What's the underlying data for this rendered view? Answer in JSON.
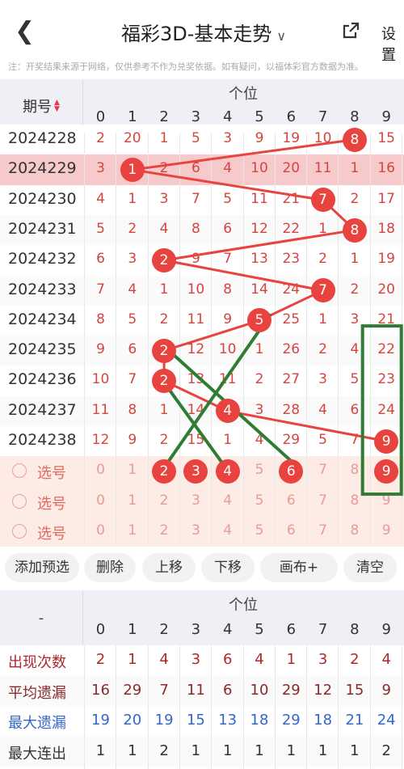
{
  "header": {
    "back_icon": "chevron-left-icon",
    "title": "福彩3D-基本走势",
    "share_icon": "share-icon",
    "settings_label": "设置"
  },
  "notice": "注：开奖结果来源于网络，仅供参考不作为兑奖依据。如有疑问，以福体彩官方数据为准。",
  "trend": {
    "period_header": "期号",
    "group_header": "个位",
    "digits": [
      "0",
      "1",
      "2",
      "3",
      "4",
      "5",
      "6",
      "7",
      "8",
      "9"
    ],
    "rows": [
      {
        "period": "2024228",
        "values": [
          "2",
          "20",
          "1",
          "5",
          "3",
          "9",
          "19",
          "10",
          "8",
          "15"
        ],
        "hit": 8
      },
      {
        "period": "2024229",
        "values": [
          "3",
          "1",
          "2",
          "6",
          "4",
          "10",
          "20",
          "11",
          "1",
          "16"
        ],
        "hit": 1,
        "highlight": true
      },
      {
        "period": "2024230",
        "values": [
          "4",
          "1",
          "3",
          "7",
          "5",
          "11",
          "21",
          "7",
          "2",
          "17"
        ],
        "hit": 7
      },
      {
        "period": "2024231",
        "values": [
          "5",
          "2",
          "4",
          "8",
          "6",
          "12",
          "22",
          "1",
          "8",
          "18"
        ],
        "hit": 8
      },
      {
        "period": "2024232",
        "values": [
          "6",
          "3",
          "2",
          "9",
          "7",
          "13",
          "23",
          "2",
          "1",
          "19"
        ],
        "hit": 2
      },
      {
        "period": "2024233",
        "values": [
          "7",
          "4",
          "1",
          "10",
          "8",
          "14",
          "24",
          "7",
          "2",
          "20"
        ],
        "hit": 7
      },
      {
        "period": "2024234",
        "values": [
          "8",
          "5",
          "2",
          "11",
          "9",
          "5",
          "25",
          "1",
          "3",
          "21"
        ],
        "hit": 5
      },
      {
        "period": "2024235",
        "values": [
          "9",
          "6",
          "2",
          "12",
          "10",
          "1",
          "26",
          "2",
          "4",
          "22"
        ],
        "hit": 2
      },
      {
        "period": "2024236",
        "values": [
          "10",
          "7",
          "2",
          "13",
          "11",
          "2",
          "27",
          "3",
          "5",
          "23"
        ],
        "hit": 2
      },
      {
        "period": "2024237",
        "values": [
          "11",
          "8",
          "1",
          "14",
          "4",
          "3",
          "28",
          "4",
          "6",
          "24"
        ],
        "hit": 4
      },
      {
        "period": "2024238",
        "values": [
          "12",
          "9",
          "2",
          "15",
          "1",
          "4",
          "29",
          "5",
          "7",
          "9"
        ],
        "hit": 9
      }
    ],
    "select_label": "选号",
    "select_rows": [
      {
        "values": [
          "0",
          "1",
          "2",
          "3",
          "4",
          "5",
          "6",
          "7",
          "8",
          "9"
        ],
        "selected": [
          2,
          3,
          4,
          6,
          9
        ]
      },
      {
        "values": [
          "0",
          "1",
          "2",
          "3",
          "4",
          "5",
          "6",
          "7",
          "8",
          "9"
        ],
        "selected": []
      },
      {
        "values": [
          "0",
          "1",
          "2",
          "3",
          "4",
          "5",
          "6",
          "7",
          "8",
          "9"
        ],
        "selected": []
      }
    ]
  },
  "toolbar": {
    "add": "添加预选",
    "delete": "删除",
    "up": "上移",
    "down": "下移",
    "canvas": "画布+",
    "clear": "清空"
  },
  "stats": {
    "corner": "-",
    "group_header": "个位",
    "digits": [
      "0",
      "1",
      "2",
      "3",
      "4",
      "5",
      "6",
      "7",
      "8",
      "9"
    ],
    "rows": [
      {
        "label": "出现次数",
        "color": "#b0282e",
        "values": [
          "2",
          "1",
          "4",
          "3",
          "6",
          "4",
          "1",
          "3",
          "2",
          "4"
        ]
      },
      {
        "label": "平均遗漏",
        "color": "#8a2a2a",
        "values": [
          "16",
          "29",
          "7",
          "11",
          "6",
          "10",
          "29",
          "12",
          "15",
          "9"
        ]
      },
      {
        "label": "最大遗漏",
        "color": "#3467c7",
        "values": [
          "19",
          "20",
          "19",
          "15",
          "13",
          "18",
          "29",
          "18",
          "21",
          "24"
        ]
      },
      {
        "label": "最大连出",
        "color": "#333333",
        "values": [
          "1",
          "1",
          "2",
          "1",
          "1",
          "1",
          "1",
          "1",
          "1",
          "2"
        ]
      }
    ]
  },
  "colors": {
    "ball": "#e8433e",
    "cell_text": "#d5453f",
    "annotation": "#2e7d32",
    "highlight_row": "#f6caca"
  }
}
